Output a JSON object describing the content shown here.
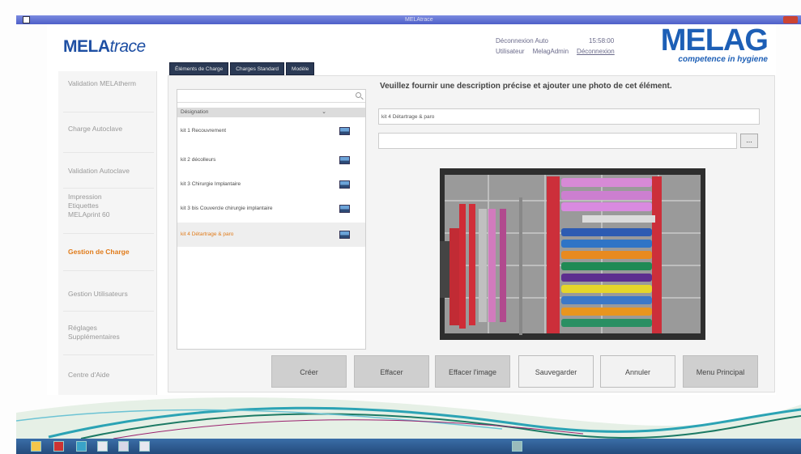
{
  "window": {
    "title": "MELAtrace"
  },
  "brand": {
    "product_main": "MELA",
    "product_italic": "trace",
    "company": "MELAG",
    "tagline": "competence in hygiene"
  },
  "status": {
    "logout_label": "Déconnexion Auto",
    "logout_value": "15:58:00",
    "user_label": "Utilisateur",
    "user_value": "MelagAdmin",
    "disconnect_link": "Déconnexion"
  },
  "sidebar": {
    "items": [
      {
        "label": "Validation MELAtherm"
      },
      {
        "label": "Charge Autoclave"
      },
      {
        "label": "Validation Autoclave"
      },
      {
        "label": "Impression Etiquettes MELAprint 60"
      },
      {
        "label": "Gestion de Charge",
        "active": true
      },
      {
        "label": "Gestion Utilisateurs"
      },
      {
        "label": "Réglages Supplémentaires"
      },
      {
        "label": "Centre d'Aide"
      }
    ]
  },
  "tabs": [
    {
      "label": "Éléments de Charge"
    },
    {
      "label": "Charges Standard"
    },
    {
      "label": "Modèle"
    }
  ],
  "list": {
    "search_placeholder": "",
    "column_header": "Désignation",
    "items": [
      {
        "label": "kit 1 Recouvrement"
      },
      {
        "label": "kit 2 décolleurs"
      },
      {
        "label": "kit 3 Chirurgie Implantaire"
      },
      {
        "label": "kit 3 bis Couvercle chirurgie implantaire"
      },
      {
        "label": "kit 4 Détartrage & paro",
        "selected": true
      }
    ]
  },
  "detail": {
    "heading": "Veuillez fournir une description précise et ajouter une photo de cet élément.",
    "name_value": "kit 4 Détartrage & paro",
    "photo_path": "",
    "browse_label": "..."
  },
  "buttons": {
    "create": "Créer",
    "delete": "Effacer",
    "delete_image": "Effacer l'image",
    "save": "Sauvegarder",
    "cancel": "Annuler",
    "main_menu": "Menu Principal"
  },
  "colors": {
    "accent": "#e07b1a",
    "brand": "#1d5fb6",
    "tab_bg": "#2b3a55"
  }
}
